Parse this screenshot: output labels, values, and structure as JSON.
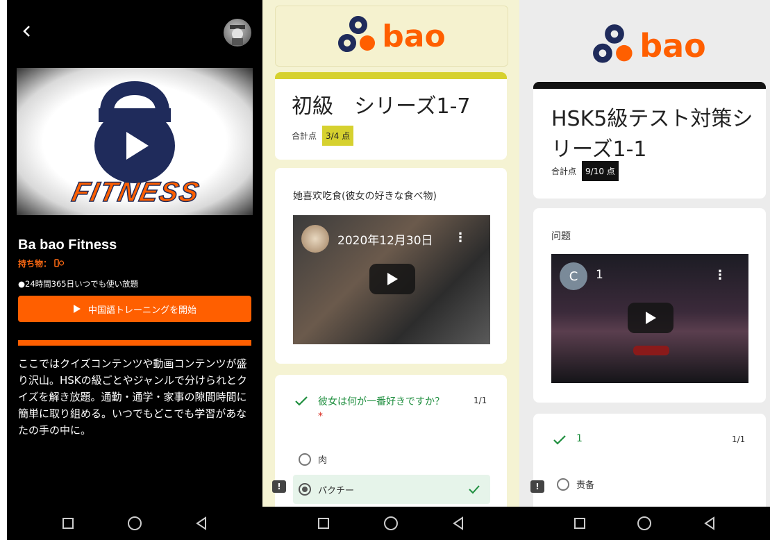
{
  "phone1": {
    "hero_title": "FITNESS",
    "app_title": "Ba bao Fitness",
    "belongings": "持ち物：",
    "feature": "●24時間365日いつでも使い放題",
    "start_button": "中国語トレーニングを開始",
    "description": "ここではクイズコンテンツや動画コンテンツが盛り沢山。HSKの級ごとやジャンルで分けられとクイズを解き放題。通勤・通学・家事の隙間時間に簡単に取り組める。いつでもどこでも学習があなたの手の中に。",
    "colors": {
      "accent": "#ff5f00",
      "navy": "#1f2b5b"
    }
  },
  "phone2": {
    "logo_text": "bao",
    "form_title": "初級　シリーズ1-7",
    "score_label": "合計点",
    "score_value": "3/4 点",
    "question1": "她喜欢吃食(彼女の好きな食べ物)",
    "video_date": "2020年12月30日",
    "question2": "彼女は何が一番好きですか？",
    "question2_points": "1/1",
    "required_mark": "*",
    "options": [
      "肉",
      "パクチー"
    ],
    "selected_option": "パクチー",
    "colors": {
      "bg": "#f5f3d3",
      "accent_bar": "#d6d12f",
      "score_bg": "#d6d12f",
      "correct": "#1e8e3e"
    }
  },
  "phone3": {
    "logo_text": "bao",
    "form_title": "HSK5級テスト対策シリーズ1-1",
    "score_label": "合計点",
    "score_value": "9/10 点",
    "question1": "问题",
    "video_channel_initial": "C",
    "video_title": "1",
    "question2": "1",
    "question2_points": "1/1",
    "options": [
      "责备"
    ],
    "colors": {
      "bg": "#ececec",
      "accent_bar": "#111111",
      "score_bg": "#111111"
    }
  }
}
